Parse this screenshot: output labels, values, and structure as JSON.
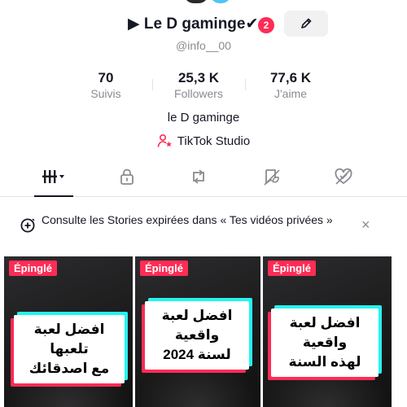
{
  "profile": {
    "username": "▶ Le D gaminge✔",
    "notification_count": "2",
    "handle": "@info__00",
    "bio": "le D gaminge",
    "studio_label": "TikTok Studio"
  },
  "stats": [
    {
      "value": "70",
      "label": "Suivis"
    },
    {
      "value": "25,3 K",
      "label": "Followers"
    },
    {
      "value": "77,6 K",
      "label": "J'aime"
    }
  ],
  "tabs": [
    {
      "icon": "grid-icon",
      "active": true
    },
    {
      "icon": "lock-icon",
      "active": false
    },
    {
      "icon": "repost-icon",
      "active": false
    },
    {
      "icon": "favorites-icon",
      "active": false
    },
    {
      "icon": "liked-icon",
      "active": false
    }
  ],
  "stories_banner": {
    "text": "Consulte les Stories expirées dans « Tes vidéos privées »",
    "close": "×"
  },
  "videos": [
    {
      "badge": "Épinglé",
      "card_line1": "افضل لعبة تلعبها",
      "card_line2": "مع اصدقائك"
    },
    {
      "badge": "Épinglé",
      "card_line1": "افضل لعبة واقعية",
      "card_line2": "لسنة 2024"
    },
    {
      "badge": "Épinglé",
      "card_line1": "افضل لعبة واقعية",
      "card_line2": "لهذه السنة"
    }
  ],
  "colors": {
    "accent": "#fe2c55",
    "cyan": "#25f4ee",
    "text_secondary": "#8a8b91"
  }
}
